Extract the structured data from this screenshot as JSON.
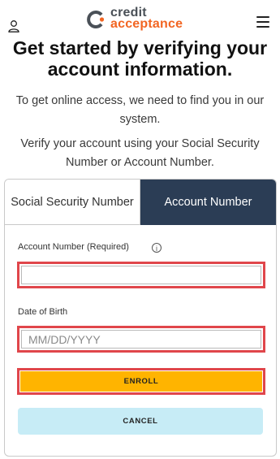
{
  "header": {
    "logo_line1": "credit",
    "logo_line2": "acceptance",
    "user_icon": "user-icon",
    "menu_icon": "hamburger-menu-icon"
  },
  "title": "Get started by verifying your account information.",
  "intro": "To get online access, we need to find you in our system.",
  "instruction": "Verify your account using your Social Security Number or Account Number.",
  "tabs": [
    {
      "label": "Social Security Number",
      "active": false
    },
    {
      "label": "Account Number",
      "active": true
    }
  ],
  "form": {
    "account_label": "Account Number (Required)",
    "account_value": "",
    "dob_label": "Date of Birth",
    "dob_placeholder": "MM/DD/YYYY",
    "enroll_label": "ENROLL",
    "cancel_label": "CANCEL"
  },
  "colors": {
    "brand_orange": "#f26522",
    "tab_active": "#2b3d55",
    "enroll_button": "#ffb400",
    "cancel_button": "#c7ecf6",
    "highlight_border": "#e0464b"
  }
}
